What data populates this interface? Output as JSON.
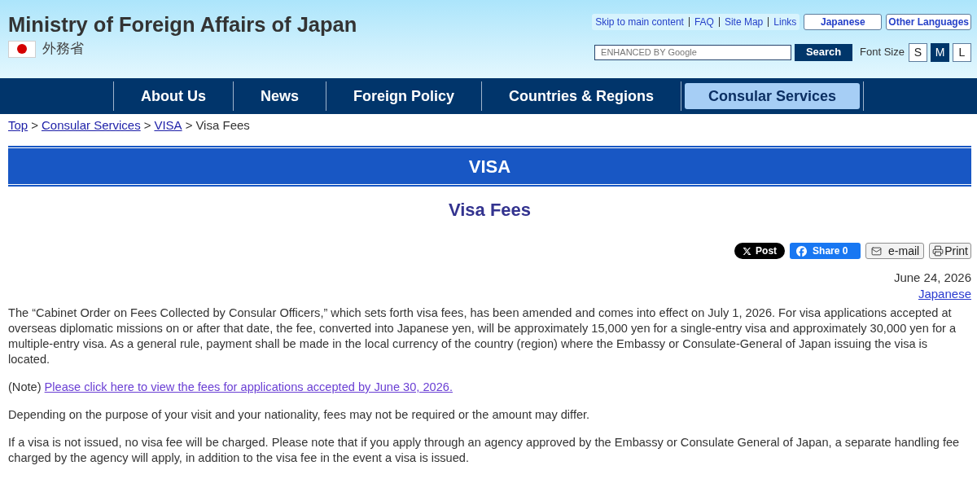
{
  "header": {
    "title": "Ministry of Foreign Affairs of Japan",
    "subtitle": "外務省"
  },
  "utility_links": [
    "Skip to main content",
    "FAQ",
    "Site Map",
    "Links"
  ],
  "language_buttons": [
    "Japanese",
    "Other Languages"
  ],
  "search": {
    "placeholder": "ENHANCED BY Google",
    "button": "Search"
  },
  "font_size": {
    "label": "Font Size",
    "options": [
      {
        "label": "S",
        "selected": false
      },
      {
        "label": "M",
        "selected": true
      },
      {
        "label": "L",
        "selected": false
      }
    ]
  },
  "nav": [
    {
      "label": "About Us",
      "selected": false
    },
    {
      "label": "News",
      "selected": false
    },
    {
      "label": "Foreign Policy",
      "selected": false
    },
    {
      "label": "Countries & Regions",
      "selected": false
    },
    {
      "label": "Consular Services",
      "selected": true
    }
  ],
  "breadcrumb": {
    "separator": ">",
    "items": [
      {
        "label": "Top",
        "kind": "link"
      },
      {
        "label": "Consular Services",
        "kind": "link"
      },
      {
        "label": "VISA",
        "kind": "link"
      },
      {
        "label": "Visa Fees",
        "kind": "current"
      }
    ]
  },
  "section_banner": "VISA",
  "page_title": "Visa Fees",
  "share_buttons": [
    {
      "kind": "x",
      "label": "Post"
    },
    {
      "kind": "facebook",
      "label": "Share 0"
    },
    {
      "kind": "email",
      "label": "e-mail"
    },
    {
      "kind": "print",
      "label": "Print"
    }
  ],
  "date": "June 24, 2026",
  "language_link": "Japanese",
  "paragraphs": [
    {
      "kind": "text",
      "text": "The “Cabinet Order on Fees Collected by Consular Officers,” which sets forth visa fees, has been amended and comes into effect on July 1, 2026. For visa applications accepted at overseas diplomatic missions on or after that date, the fee, converted into Japanese yen, will be approximately 15,000 yen for a single-entry visa and approximately 30,000 yen for a multiple-entry visa. As a general rule, payment shall be made in the local currency of the country (region) where the Embassy or Consulate-General of Japan issuing the visa is located."
    },
    {
      "kind": "note",
      "prefix": "(Note)",
      "link": "Please click here to view the fees for applications accepted by June 30, 2026."
    },
    {
      "kind": "text",
      "text": "Depending on the purpose of your visit and your nationality, fees may not be required or the amount may differ."
    },
    {
      "kind": "text",
      "text": "If a visa is not issued, no visa fee will be charged. Please note that if you apply through an agency approved by the Embassy or Consulate General of Japan, a separate handling fee charged by the agency will apply, in addition to the visa fee in the event a visa is issued."
    }
  ]
}
